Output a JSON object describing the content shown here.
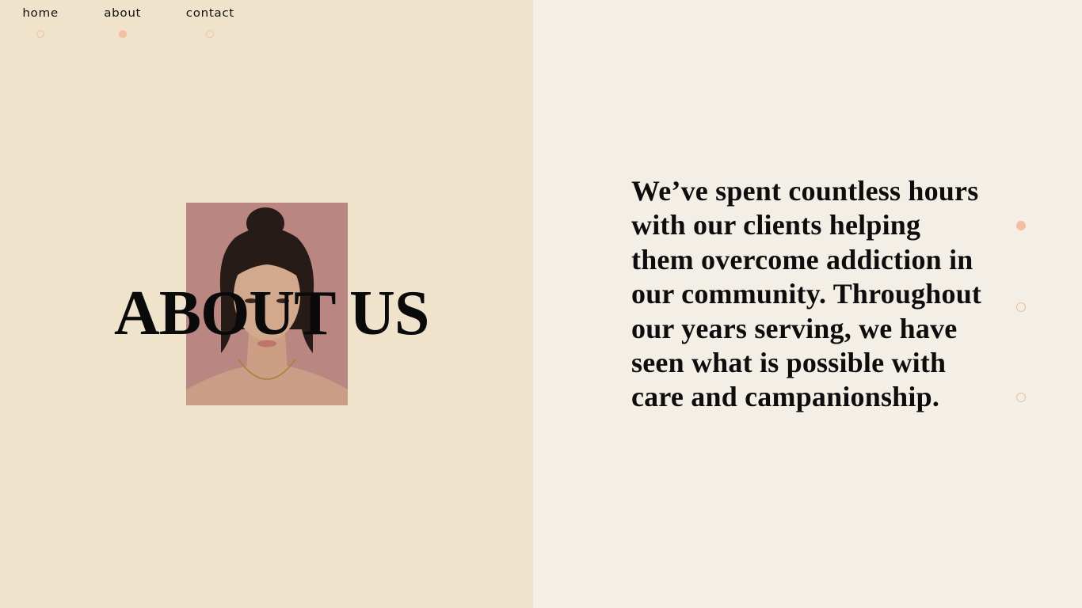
{
  "nav": {
    "items": [
      {
        "label": "home",
        "active": false
      },
      {
        "label": "about",
        "active": true
      },
      {
        "label": "contact",
        "active": false
      }
    ]
  },
  "hero": {
    "title": "ABOUT US",
    "photo_icon": "portrait-photo"
  },
  "content": {
    "paragraph": "We’ve spent countless hours with our clients helping them overcome addiction in our community. Throughout our years serving, we have seen what is possible with care and campanionship."
  },
  "section_pager": {
    "active_index": 0,
    "count": 3
  },
  "colors": {
    "left_background": "#efe3cb",
    "right_background": "#f3eee6",
    "accent": "#f4bf9f",
    "text": "#0a0a0a",
    "photo_background": "#c68f8b"
  }
}
